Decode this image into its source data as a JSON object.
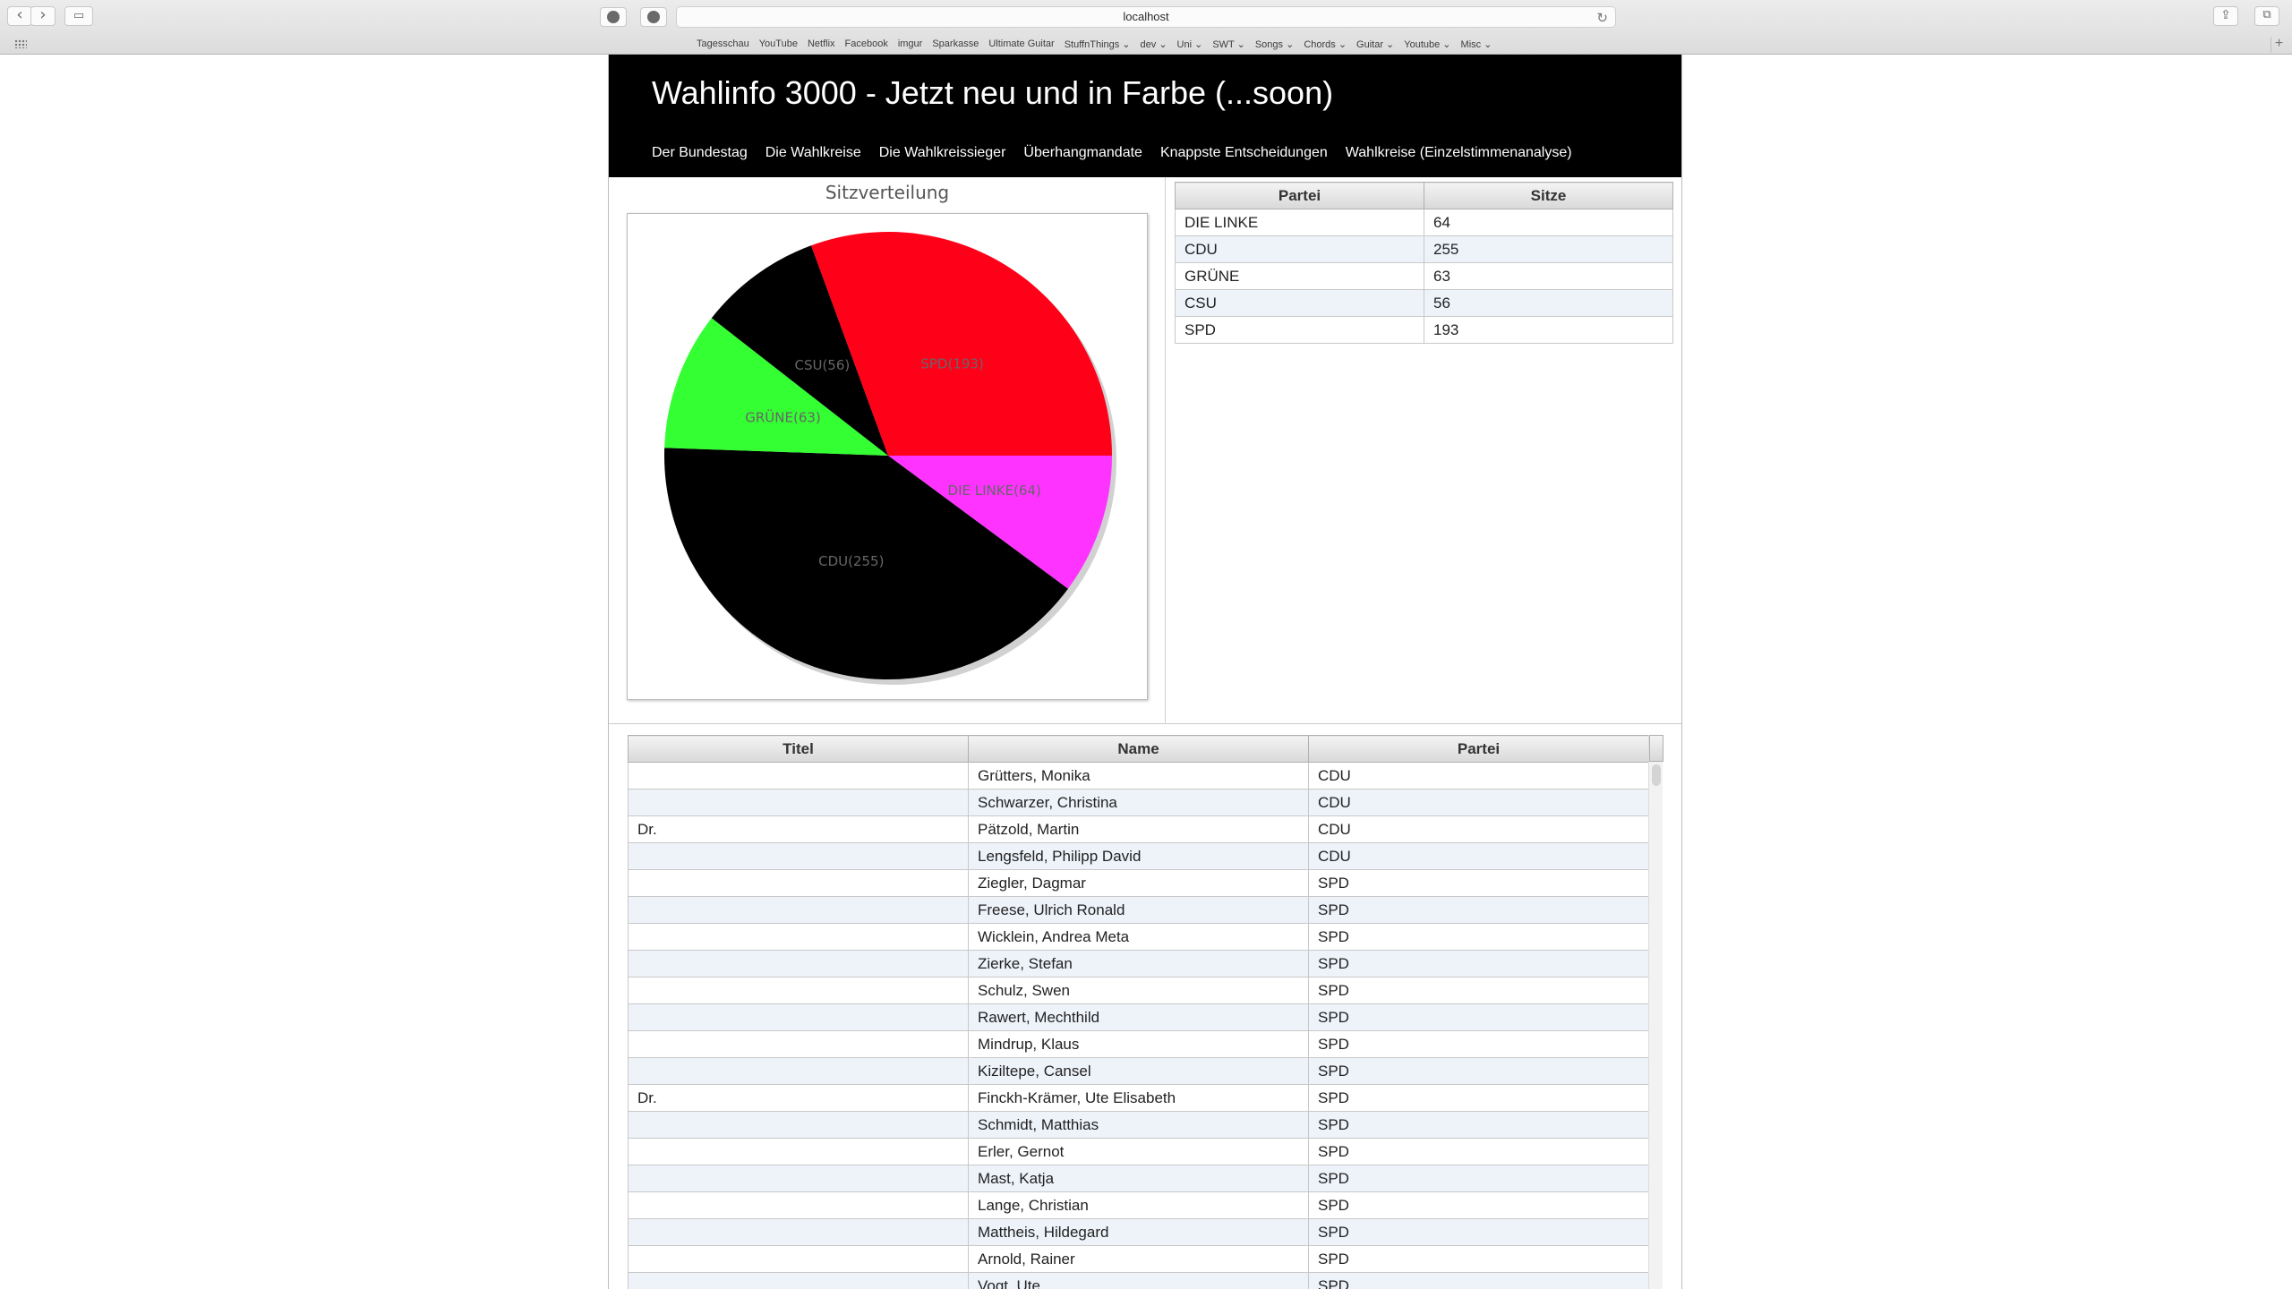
{
  "browser": {
    "url": "localhost",
    "bookmarks": [
      "Tagesschau",
      "YouTube",
      "Netflix",
      "Facebook",
      "imgur",
      "Sparkasse",
      "Ultimate Guitar",
      "StuffnThings ⌄",
      "dev ⌄",
      "Uni ⌄",
      "SWT ⌄",
      "Songs ⌄",
      "Chords ⌄",
      "Guitar ⌄",
      "Youtube ⌄",
      "Misc ⌄"
    ]
  },
  "header": {
    "title": "Wahlinfo 3000 - Jetzt neu und in Farbe (...soon)",
    "nav": [
      "Der Bundestag",
      "Die Wahlkreise",
      "Die Wahlkreissieger",
      "Überhangmandate",
      "Knappste Entscheidungen",
      "Wahlkreise (Einzelstimmenanalyse)"
    ]
  },
  "chart_data": {
    "type": "pie",
    "title": "Sitzverteilung",
    "slices": [
      {
        "label": "DIE LINKE(64)",
        "value": 64,
        "color": "#ff33ff"
      },
      {
        "label": "CDU(255)",
        "value": 255,
        "color": "#000000"
      },
      {
        "label": "GRÜNE(63)",
        "value": 63,
        "color": "#33ff33"
      },
      {
        "label": "CSU(56)",
        "value": 56,
        "color": "#000000"
      },
      {
        "label": "SPD(193)",
        "value": 193,
        "color": "#ff0019"
      }
    ]
  },
  "seats_table": {
    "headers": [
      "Partei",
      "Sitze"
    ],
    "rows": [
      [
        "DIE LINKE",
        "64"
      ],
      [
        "CDU",
        "255"
      ],
      [
        "GRÜNE",
        "63"
      ],
      [
        "CSU",
        "56"
      ],
      [
        "SPD",
        "193"
      ]
    ]
  },
  "members_table": {
    "headers": [
      "Titel",
      "Name",
      "Partei"
    ],
    "rows": [
      [
        "",
        "Grütters, Monika",
        "CDU"
      ],
      [
        "",
        "Schwarzer, Christina",
        "CDU"
      ],
      [
        "Dr.",
        "Pätzold, Martin",
        "CDU"
      ],
      [
        "",
        "Lengsfeld, Philipp David",
        "CDU"
      ],
      [
        "",
        "Ziegler, Dagmar",
        "SPD"
      ],
      [
        "",
        "Freese, Ulrich Ronald",
        "SPD"
      ],
      [
        "",
        "Wicklein, Andrea Meta",
        "SPD"
      ],
      [
        "",
        "Zierke, Stefan",
        "SPD"
      ],
      [
        "",
        "Schulz, Swen",
        "SPD"
      ],
      [
        "",
        "Rawert, Mechthild",
        "SPD"
      ],
      [
        "",
        "Mindrup, Klaus",
        "SPD"
      ],
      [
        "",
        "Kiziltepe, Cansel",
        "SPD"
      ],
      [
        "Dr.",
        "Finckh-Krämer, Ute Elisabeth",
        "SPD"
      ],
      [
        "",
        "Schmidt, Matthias",
        "SPD"
      ],
      [
        "",
        "Erler, Gernot",
        "SPD"
      ],
      [
        "",
        "Mast, Katja",
        "SPD"
      ],
      [
        "",
        "Lange, Christian",
        "SPD"
      ],
      [
        "",
        "Mattheis, Hildegard",
        "SPD"
      ],
      [
        "",
        "Arnold, Rainer",
        "SPD"
      ],
      [
        "",
        "Vogt, Ute",
        "SPD"
      ]
    ]
  }
}
